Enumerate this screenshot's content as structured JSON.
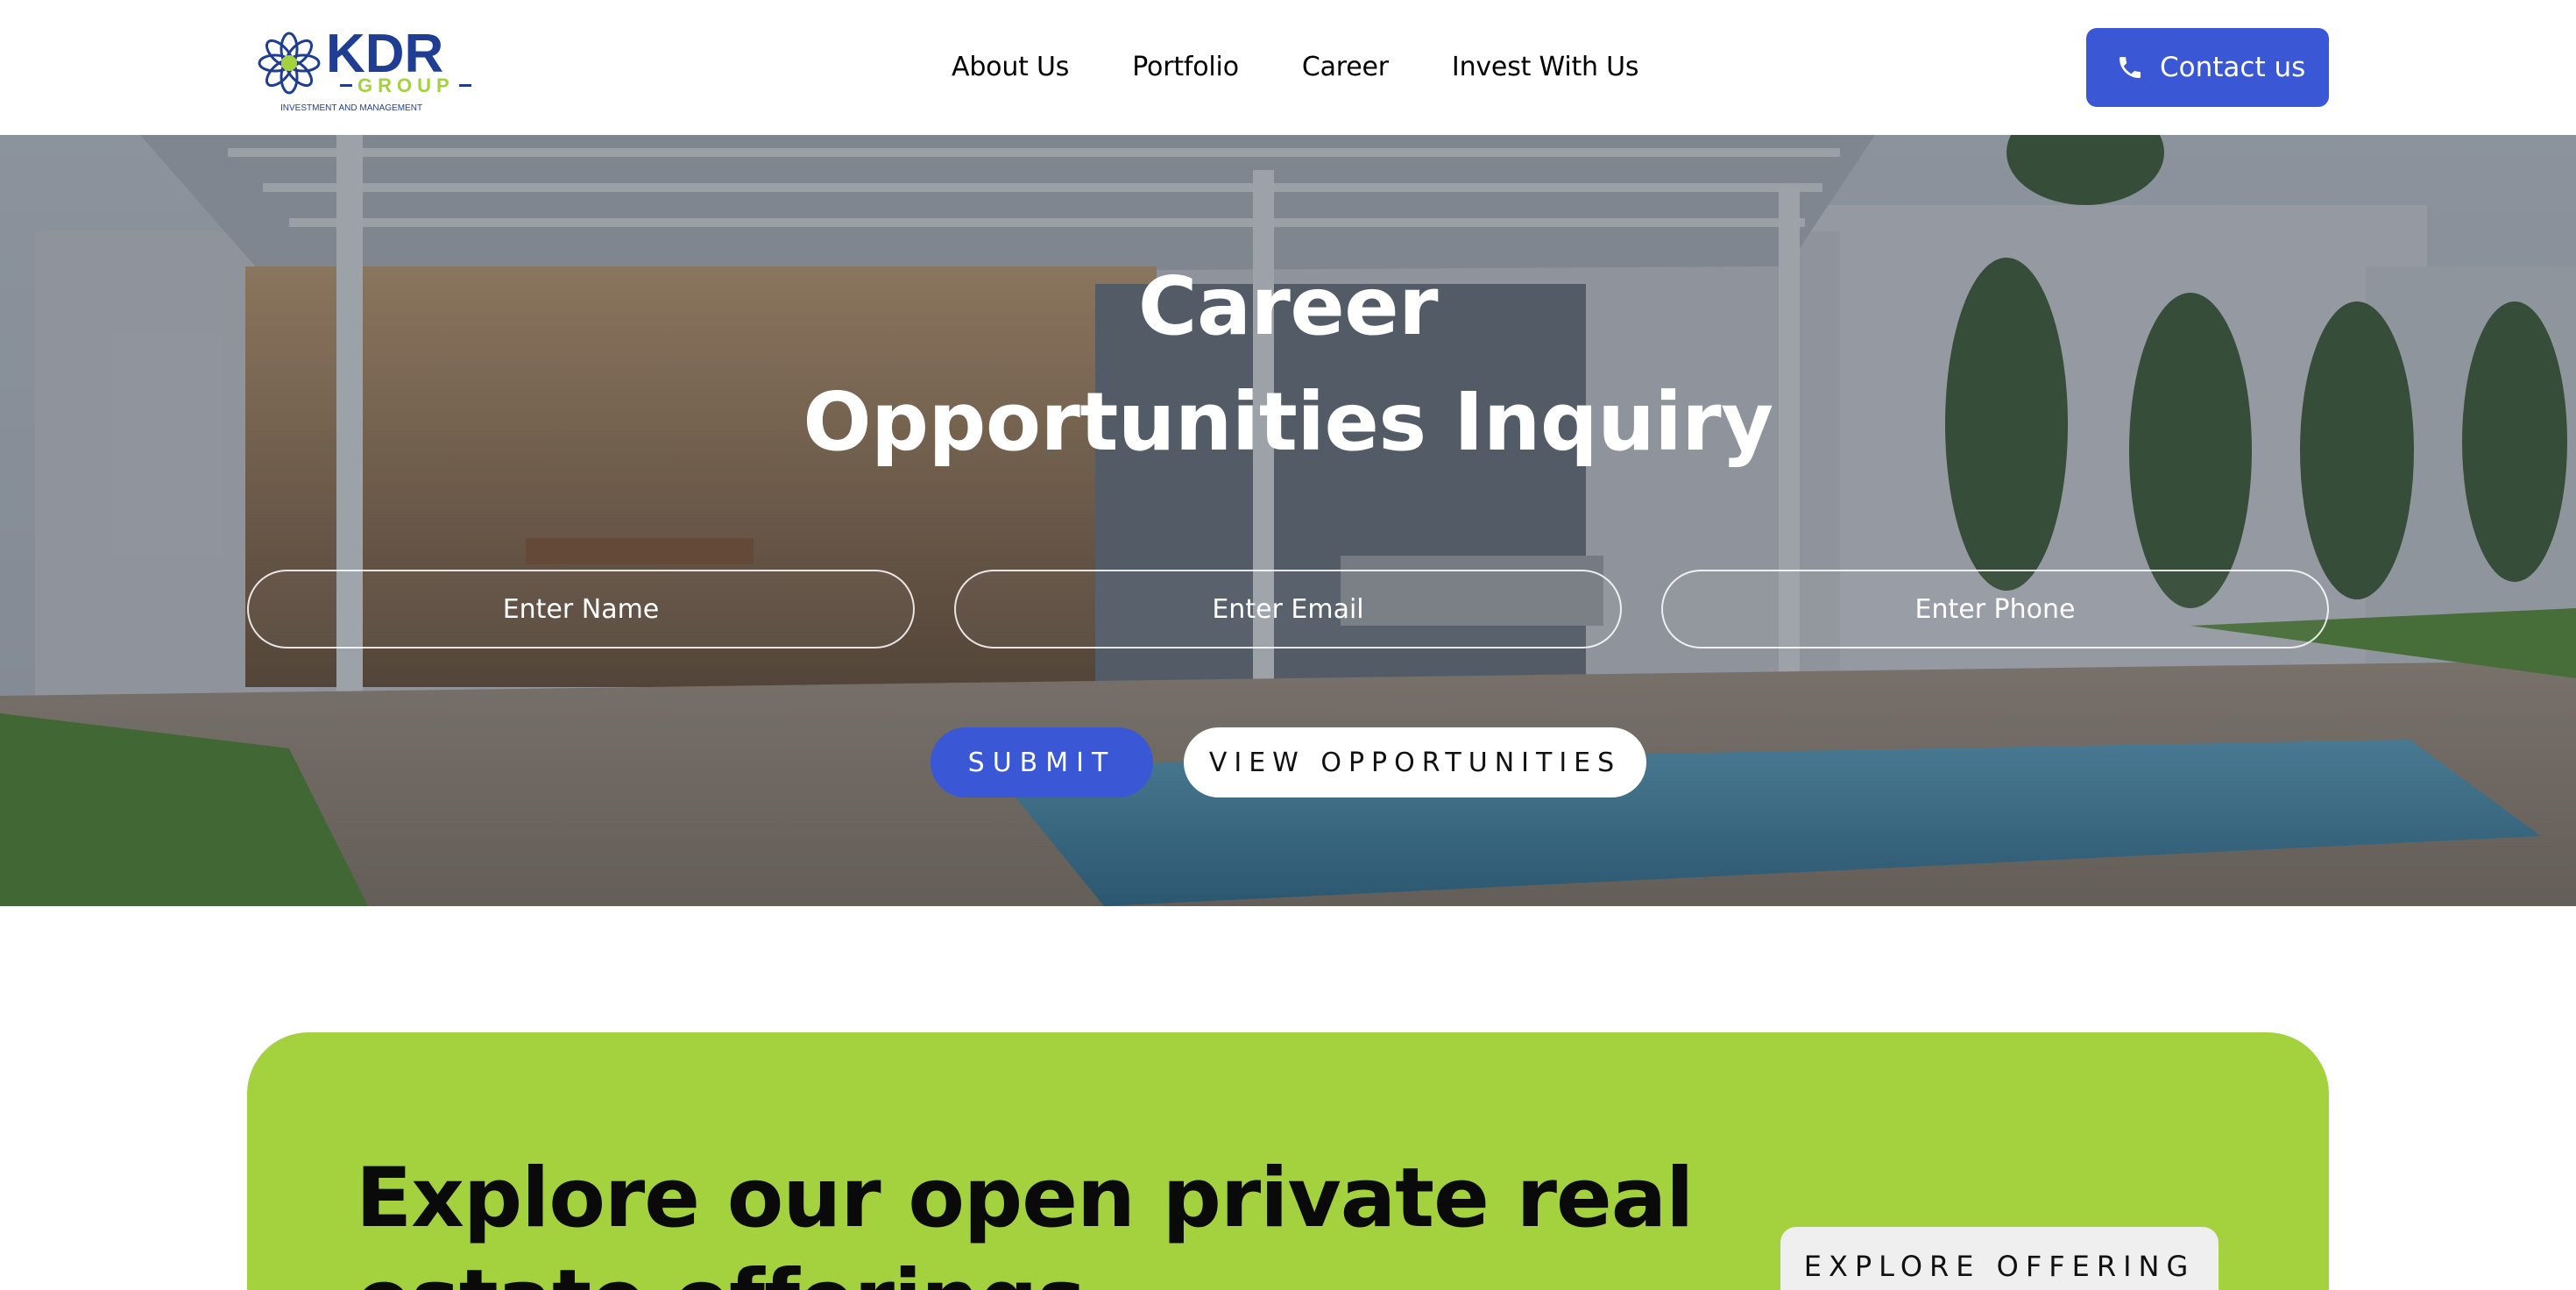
{
  "header": {
    "logo": {
      "brand": "KDR",
      "group": "GROUP",
      "tagline": "INVESTMENT AND MANAGEMENT",
      "brand_color": "#1f3e93",
      "accent_color": "#a4d13e"
    },
    "nav": [
      {
        "label": "About Us"
      },
      {
        "label": "Portfolio"
      },
      {
        "label": "Career"
      },
      {
        "label": "Invest With Us"
      }
    ],
    "contact": {
      "label": "Contact us",
      "icon": "phone-icon",
      "color": "#3a58d6"
    }
  },
  "hero": {
    "title_line1": "Career",
    "title_line2": "Opportunities Inquiry",
    "fields": {
      "name_placeholder": "Enter Name",
      "email_placeholder": "Enter Email",
      "phone_placeholder": "Enter Phone"
    },
    "submit_label": "SUBMIT",
    "view_label": "VIEW OPPORTUNITIES"
  },
  "offering": {
    "title": "Explore our open private real estate offerings",
    "button_label": "EXPLORE OFFERING",
    "background_color": "#a4d13e"
  }
}
